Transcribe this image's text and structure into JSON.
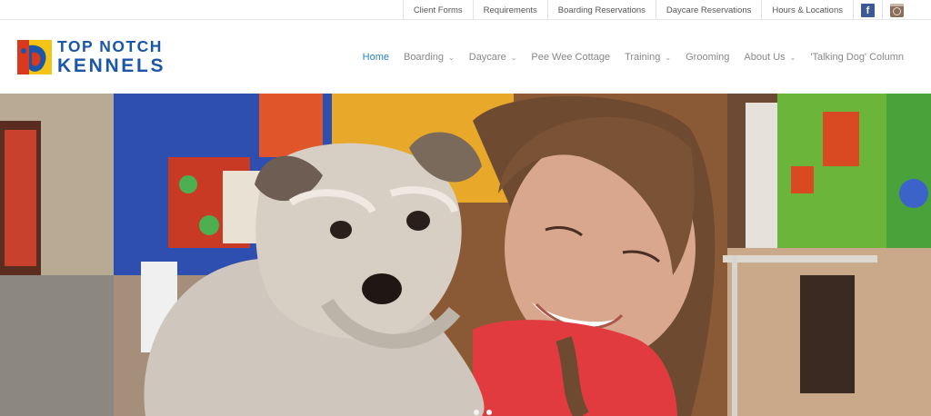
{
  "topbar": {
    "links": [
      "Client Forms",
      "Requirements",
      "Boarding Reservations",
      "Daycare Reservations",
      "Hours & Locations"
    ],
    "social": [
      "facebook-icon",
      "instagram-icon"
    ]
  },
  "logo": {
    "line1": "TOP NOTCH",
    "line2": "KENNELS"
  },
  "nav": {
    "items": [
      {
        "label": "Home",
        "active": true,
        "dropdown": false
      },
      {
        "label": "Boarding",
        "dropdown": true
      },
      {
        "label": "Daycare",
        "dropdown": true
      },
      {
        "label": "Pee Wee Cottage",
        "dropdown": false
      },
      {
        "label": "Training",
        "dropdown": true
      },
      {
        "label": "Grooming",
        "dropdown": false
      },
      {
        "label": "About Us",
        "dropdown": true
      },
      {
        "label": "'Talking Dog' Column",
        "dropdown": false
      }
    ]
  },
  "colors": {
    "brand_blue": "#1b56a8",
    "active_nav": "#2a83c6",
    "facebook": "#3b5998"
  }
}
